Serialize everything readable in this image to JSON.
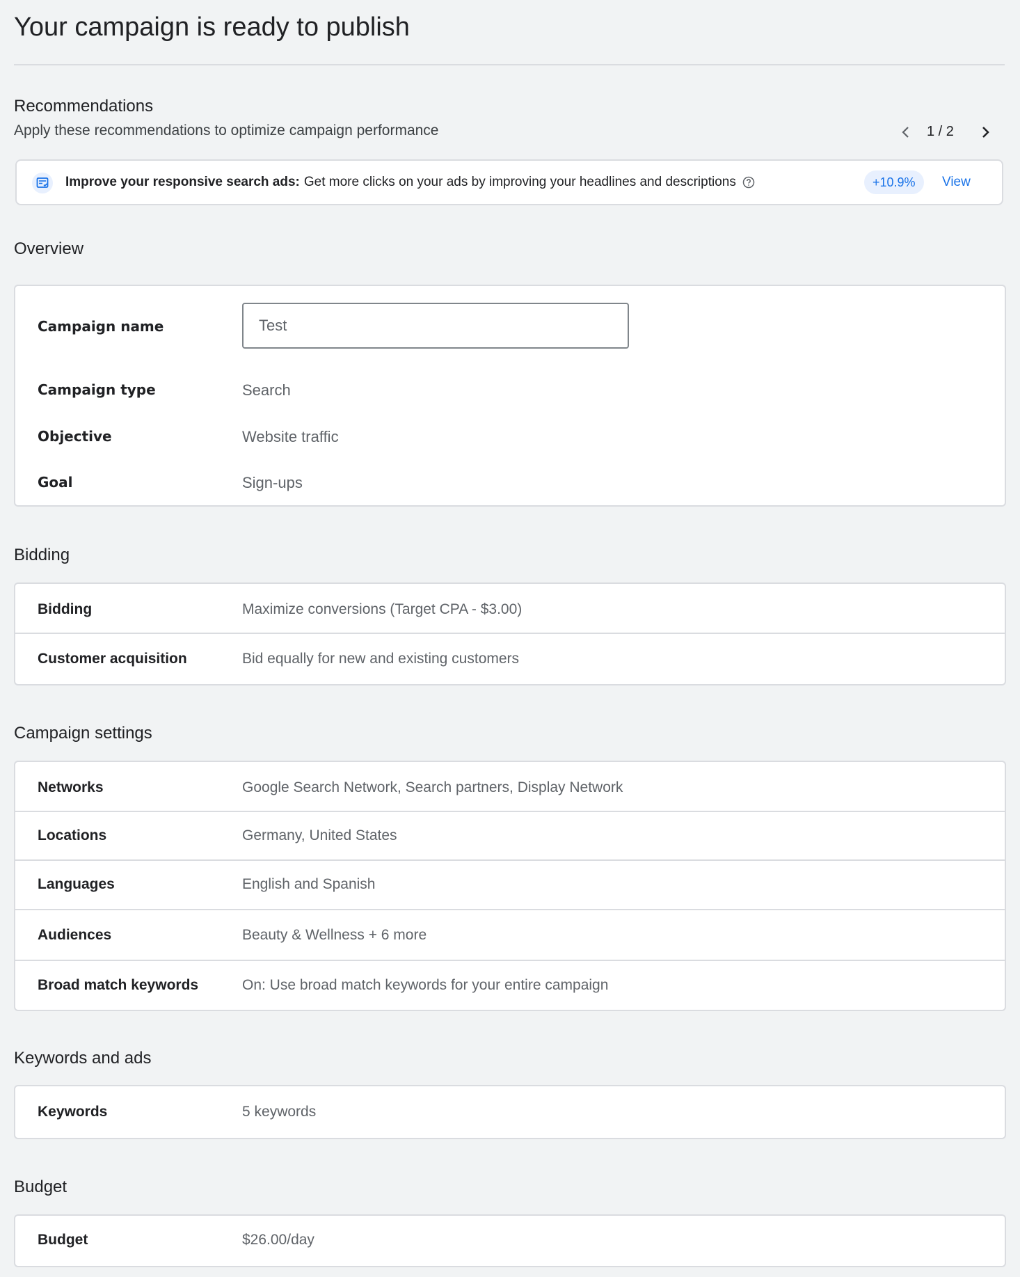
{
  "page": {
    "title": "Your campaign is ready to publish"
  },
  "recommendations": {
    "title": "Recommendations",
    "subtitle": "Apply these recommendations to optimize campaign performance",
    "pager": "1 / 2",
    "item": {
      "icon": "ad-improve-icon",
      "bold_text": "Improve your responsive search ads:",
      "text": "Get more clicks on your ads by improving your headlines and descriptions",
      "uplift": "+10.9%",
      "action": "View"
    }
  },
  "overview": {
    "title": "Overview",
    "campaign_name_label": "Campaign name",
    "campaign_name_value": "Test",
    "rows": [
      {
        "label": "Campaign type",
        "value": "Search"
      },
      {
        "label": "Objective",
        "value": "Website traffic"
      },
      {
        "label": "Goal",
        "value": "Sign-ups"
      }
    ]
  },
  "bidding": {
    "title": "Bidding",
    "rows": [
      {
        "label": "Bidding",
        "value": "Maximize conversions (Target CPA - $3.00)"
      },
      {
        "label": "Customer acquisition",
        "value": "Bid equally for new and existing customers"
      }
    ]
  },
  "campaign_settings": {
    "title": "Campaign settings",
    "rows": [
      {
        "label": "Networks",
        "value": "Google Search Network, Search partners, Display Network"
      },
      {
        "label": "Locations",
        "value": "Germany, United States"
      },
      {
        "label": "Languages",
        "value": "English and Spanish"
      },
      {
        "label": "Audiences",
        "value": "Beauty & Wellness + 6 more"
      },
      {
        "label": "Broad match keywords",
        "value": "On: Use broad match keywords for your entire campaign"
      }
    ]
  },
  "keywords_ads": {
    "title": "Keywords and ads",
    "rows": [
      {
        "label": "Keywords",
        "value": "5 keywords"
      }
    ]
  },
  "budget": {
    "title": "Budget",
    "rows": [
      {
        "label": "Budget",
        "value": "$26.00/day"
      }
    ]
  },
  "colors": {
    "background": "#f1f3f4",
    "accent": "#1a73e8",
    "chip_bg": "#e8f0fe",
    "border": "#dadce0"
  }
}
